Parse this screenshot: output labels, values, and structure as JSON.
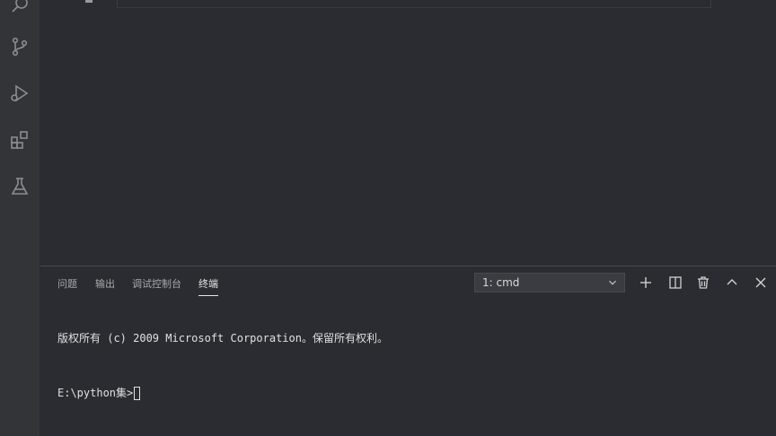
{
  "panel": {
    "tabs": [
      {
        "label": "问题"
      },
      {
        "label": "输出"
      },
      {
        "label": "调试控制台"
      },
      {
        "label": "终端",
        "active": true
      }
    ],
    "terminal_selector": {
      "value": "1: cmd"
    }
  },
  "terminal": {
    "lines": [
      "版权所有 (c) 2009 Microsoft Corporation。保留所有权利。"
    ],
    "prompt": "E:\\python集>"
  },
  "icons": {
    "activity_bar": [
      "search-icon",
      "source-control-icon",
      "run-debug-icon",
      "extensions-icon",
      "testing-flask-icon"
    ],
    "panel_actions": [
      "plus-icon",
      "split-icon",
      "trash-icon",
      "chevron-up-icon",
      "close-icon"
    ]
  },
  "colors": {
    "background": "#2b2c31",
    "activity_bar": "#333438",
    "text": "#e0e0e0"
  }
}
